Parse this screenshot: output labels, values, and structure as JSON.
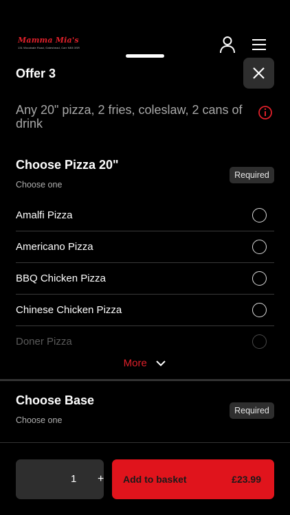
{
  "header": {
    "logo_name": "Mamma Mia's",
    "logo_address": "131 Woodvale Road, Gateshead, Carr NE8 3SR"
  },
  "offer": {
    "title": "Offer 3",
    "description": "Any 20\" pizza, 2 fries, coleslaw, 2 cans of drink"
  },
  "sections": [
    {
      "title": "Choose Pizza 20\"",
      "subtitle": "Choose one",
      "badge": "Required",
      "options": [
        {
          "label": "Amalfi Pizza"
        },
        {
          "label": "Americano Pizza"
        },
        {
          "label": "BBQ Chicken Pizza"
        },
        {
          "label": "Chinese Chicken Pizza"
        },
        {
          "label": "Doner Pizza"
        }
      ],
      "more_label": "More"
    },
    {
      "title": "Choose Base",
      "subtitle": "Choose one",
      "badge": "Required"
    }
  ],
  "footer": {
    "quantity": "1",
    "plus": "+",
    "add_label": "Add to basket",
    "price": "£23.99"
  },
  "colors": {
    "accent": "#e0141c",
    "background": "#000000",
    "surface": "#2e2e2e"
  }
}
